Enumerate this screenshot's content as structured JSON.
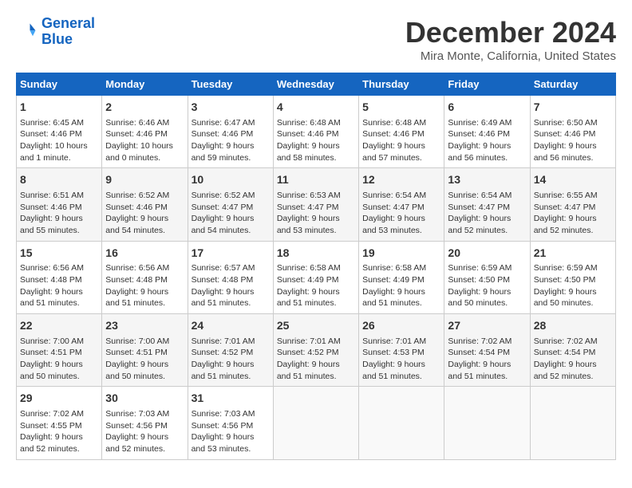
{
  "logo": {
    "line1": "General",
    "line2": "Blue"
  },
  "title": "December 2024",
  "subtitle": "Mira Monte, California, United States",
  "days_header": [
    "Sunday",
    "Monday",
    "Tuesday",
    "Wednesday",
    "Thursday",
    "Friday",
    "Saturday"
  ],
  "weeks": [
    [
      {
        "day": "1",
        "info": "Sunrise: 6:45 AM\nSunset: 4:46 PM\nDaylight: 10 hours\nand 1 minute."
      },
      {
        "day": "2",
        "info": "Sunrise: 6:46 AM\nSunset: 4:46 PM\nDaylight: 10 hours\nand 0 minutes."
      },
      {
        "day": "3",
        "info": "Sunrise: 6:47 AM\nSunset: 4:46 PM\nDaylight: 9 hours\nand 59 minutes."
      },
      {
        "day": "4",
        "info": "Sunrise: 6:48 AM\nSunset: 4:46 PM\nDaylight: 9 hours\nand 58 minutes."
      },
      {
        "day": "5",
        "info": "Sunrise: 6:48 AM\nSunset: 4:46 PM\nDaylight: 9 hours\nand 57 minutes."
      },
      {
        "day": "6",
        "info": "Sunrise: 6:49 AM\nSunset: 4:46 PM\nDaylight: 9 hours\nand 56 minutes."
      },
      {
        "day": "7",
        "info": "Sunrise: 6:50 AM\nSunset: 4:46 PM\nDaylight: 9 hours\nand 56 minutes."
      }
    ],
    [
      {
        "day": "8",
        "info": "Sunrise: 6:51 AM\nSunset: 4:46 PM\nDaylight: 9 hours\nand 55 minutes."
      },
      {
        "day": "9",
        "info": "Sunrise: 6:52 AM\nSunset: 4:46 PM\nDaylight: 9 hours\nand 54 minutes."
      },
      {
        "day": "10",
        "info": "Sunrise: 6:52 AM\nSunset: 4:47 PM\nDaylight: 9 hours\nand 54 minutes."
      },
      {
        "day": "11",
        "info": "Sunrise: 6:53 AM\nSunset: 4:47 PM\nDaylight: 9 hours\nand 53 minutes."
      },
      {
        "day": "12",
        "info": "Sunrise: 6:54 AM\nSunset: 4:47 PM\nDaylight: 9 hours\nand 53 minutes."
      },
      {
        "day": "13",
        "info": "Sunrise: 6:54 AM\nSunset: 4:47 PM\nDaylight: 9 hours\nand 52 minutes."
      },
      {
        "day": "14",
        "info": "Sunrise: 6:55 AM\nSunset: 4:47 PM\nDaylight: 9 hours\nand 52 minutes."
      }
    ],
    [
      {
        "day": "15",
        "info": "Sunrise: 6:56 AM\nSunset: 4:48 PM\nDaylight: 9 hours\nand 51 minutes."
      },
      {
        "day": "16",
        "info": "Sunrise: 6:56 AM\nSunset: 4:48 PM\nDaylight: 9 hours\nand 51 minutes."
      },
      {
        "day": "17",
        "info": "Sunrise: 6:57 AM\nSunset: 4:48 PM\nDaylight: 9 hours\nand 51 minutes."
      },
      {
        "day": "18",
        "info": "Sunrise: 6:58 AM\nSunset: 4:49 PM\nDaylight: 9 hours\nand 51 minutes."
      },
      {
        "day": "19",
        "info": "Sunrise: 6:58 AM\nSunset: 4:49 PM\nDaylight: 9 hours\nand 51 minutes."
      },
      {
        "day": "20",
        "info": "Sunrise: 6:59 AM\nSunset: 4:50 PM\nDaylight: 9 hours\nand 50 minutes."
      },
      {
        "day": "21",
        "info": "Sunrise: 6:59 AM\nSunset: 4:50 PM\nDaylight: 9 hours\nand 50 minutes."
      }
    ],
    [
      {
        "day": "22",
        "info": "Sunrise: 7:00 AM\nSunset: 4:51 PM\nDaylight: 9 hours\nand 50 minutes."
      },
      {
        "day": "23",
        "info": "Sunrise: 7:00 AM\nSunset: 4:51 PM\nDaylight: 9 hours\nand 50 minutes."
      },
      {
        "day": "24",
        "info": "Sunrise: 7:01 AM\nSunset: 4:52 PM\nDaylight: 9 hours\nand 51 minutes."
      },
      {
        "day": "25",
        "info": "Sunrise: 7:01 AM\nSunset: 4:52 PM\nDaylight: 9 hours\nand 51 minutes."
      },
      {
        "day": "26",
        "info": "Sunrise: 7:01 AM\nSunset: 4:53 PM\nDaylight: 9 hours\nand 51 minutes."
      },
      {
        "day": "27",
        "info": "Sunrise: 7:02 AM\nSunset: 4:54 PM\nDaylight: 9 hours\nand 51 minutes."
      },
      {
        "day": "28",
        "info": "Sunrise: 7:02 AM\nSunset: 4:54 PM\nDaylight: 9 hours\nand 52 minutes."
      }
    ],
    [
      {
        "day": "29",
        "info": "Sunrise: 7:02 AM\nSunset: 4:55 PM\nDaylight: 9 hours\nand 52 minutes."
      },
      {
        "day": "30",
        "info": "Sunrise: 7:03 AM\nSunset: 4:56 PM\nDaylight: 9 hours\nand 52 minutes."
      },
      {
        "day": "31",
        "info": "Sunrise: 7:03 AM\nSunset: 4:56 PM\nDaylight: 9 hours\nand 53 minutes."
      },
      null,
      null,
      null,
      null
    ]
  ]
}
